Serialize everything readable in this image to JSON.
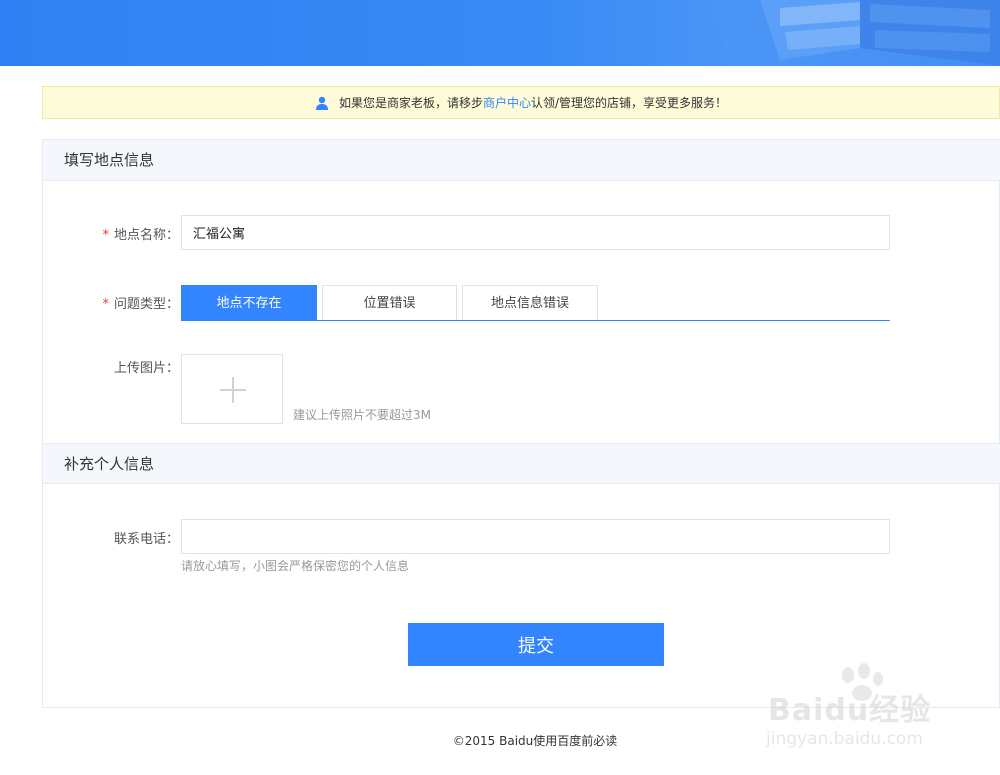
{
  "notice": {
    "prefix": "如果您是商家老板，请移步",
    "link": "商户中心",
    "suffix": "认领/管理您的店铺，享受更多服务！",
    "icon": "user-icon"
  },
  "sections": {
    "location_title": "填写地点信息",
    "personal_title": "补充个人信息"
  },
  "form": {
    "place_name": {
      "label": "地点名称：",
      "required_mark": "*",
      "value": "汇福公寓"
    },
    "issue_type": {
      "label": "问题类型：",
      "required_mark": "*",
      "tabs": [
        {
          "label": "地点不存在",
          "active": true
        },
        {
          "label": "位置错误",
          "active": false
        },
        {
          "label": "地点信息错误",
          "active": false
        }
      ]
    },
    "upload": {
      "label": "上传图片：",
      "hint": "建议上传照片不要超过3M",
      "icon": "plus-icon"
    },
    "phone": {
      "label": "联系电话：",
      "value": "",
      "hint": "请放心填写，小图会严格保密您的个人信息"
    },
    "submit_label": "提交"
  },
  "footer": {
    "text": "©2015 Baidu使用百度前必读"
  },
  "watermark": {
    "line1": "Baidu经验",
    "line2": "jingyan.baidu.com"
  },
  "colors": {
    "accent": "#3385ff",
    "banner": "#2f80f2",
    "notice_bg": "#fefbd8",
    "required": "#e4393c"
  }
}
